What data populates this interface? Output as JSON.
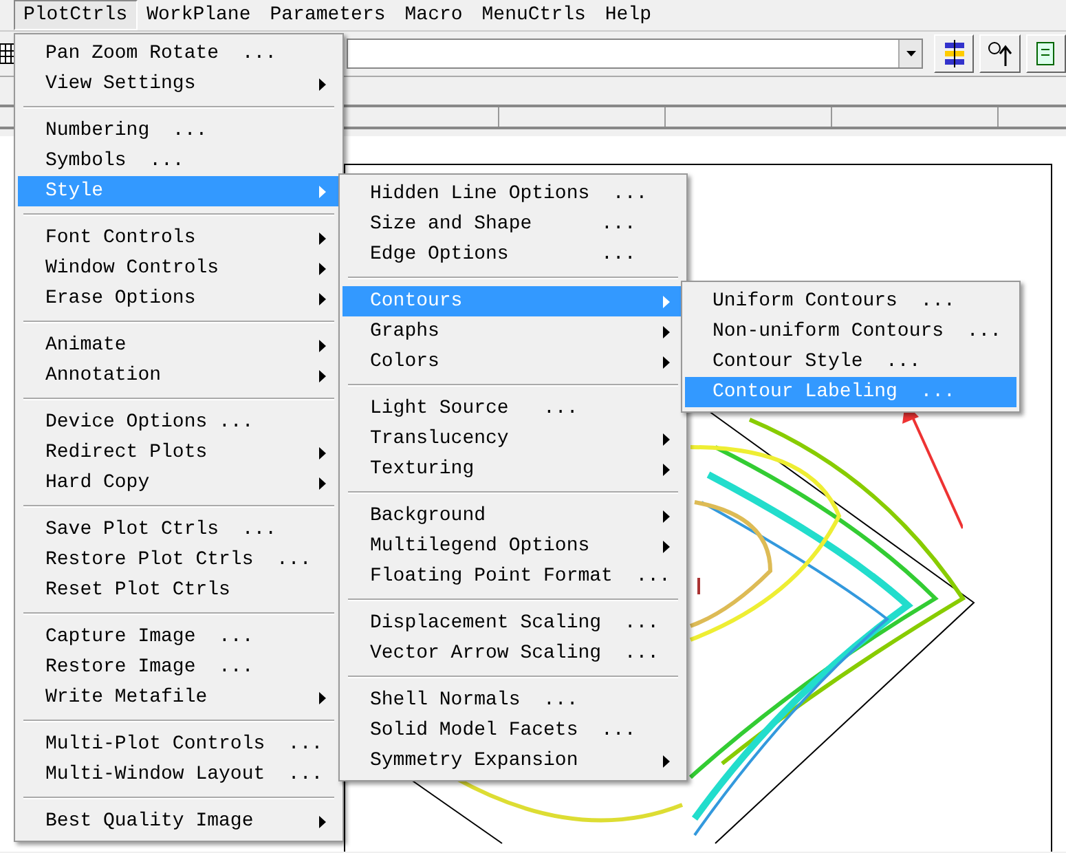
{
  "menubar": [
    {
      "label": "PlotCtrls",
      "selected": true
    },
    {
      "label": "WorkPlane",
      "selected": false
    },
    {
      "label": "Parameters",
      "selected": false
    },
    {
      "label": "Macro",
      "selected": false
    },
    {
      "label": "MenuCtrls",
      "selected": false
    },
    {
      "label": "Help",
      "selected": false
    }
  ],
  "menus": [
    {
      "groups": [
        [
          {
            "label": "Pan Zoom Rotate  ...",
            "submenu": false,
            "selected": false
          },
          {
            "label": "View Settings",
            "submenu": true,
            "selected": false
          }
        ],
        [
          {
            "label": "Numbering  ...",
            "submenu": false,
            "selected": false
          },
          {
            "label": "Symbols  ...",
            "submenu": false,
            "selected": false
          },
          {
            "label": "Style",
            "submenu": true,
            "selected": true
          }
        ],
        [
          {
            "label": "Font Controls",
            "submenu": true,
            "selected": false
          },
          {
            "label": "Window Controls",
            "submenu": true,
            "selected": false
          },
          {
            "label": "Erase Options",
            "submenu": true,
            "selected": false
          }
        ],
        [
          {
            "label": "Animate",
            "submenu": true,
            "selected": false
          },
          {
            "label": "Annotation",
            "submenu": true,
            "selected": false
          }
        ],
        [
          {
            "label": "Device Options ...",
            "submenu": false,
            "selected": false
          },
          {
            "label": "Redirect Plots",
            "submenu": true,
            "selected": false
          },
          {
            "label": "Hard Copy",
            "submenu": true,
            "selected": false
          }
        ],
        [
          {
            "label": "Save Plot Ctrls  ...",
            "submenu": false,
            "selected": false
          },
          {
            "label": "Restore Plot Ctrls  ...",
            "submenu": false,
            "selected": false
          },
          {
            "label": "Reset Plot Ctrls",
            "submenu": false,
            "selected": false
          }
        ],
        [
          {
            "label": "Capture Image  ...",
            "submenu": false,
            "selected": false
          },
          {
            "label": "Restore Image  ...",
            "submenu": false,
            "selected": false
          },
          {
            "label": "Write Metafile",
            "submenu": true,
            "selected": false
          }
        ],
        [
          {
            "label": "Multi-Plot Controls  ...",
            "submenu": false,
            "selected": false
          },
          {
            "label": "Multi-Window Layout  ...",
            "submenu": false,
            "selected": false
          }
        ],
        [
          {
            "label": "Best Quality Image",
            "submenu": true,
            "selected": false
          }
        ]
      ]
    },
    {
      "groups": [
        [
          {
            "label": "Hidden Line Options  ...",
            "submenu": false,
            "selected": false
          },
          {
            "label": "Size and Shape      ...",
            "submenu": false,
            "selected": false
          },
          {
            "label": "Edge Options        ...",
            "submenu": false,
            "selected": false
          }
        ],
        [
          {
            "label": "Contours",
            "submenu": true,
            "selected": true
          },
          {
            "label": "Graphs",
            "submenu": true,
            "selected": false
          },
          {
            "label": "Colors",
            "submenu": true,
            "selected": false
          }
        ],
        [
          {
            "label": "Light Source   ...",
            "submenu": false,
            "selected": false
          },
          {
            "label": "Translucency",
            "submenu": true,
            "selected": false
          },
          {
            "label": "Texturing",
            "submenu": true,
            "selected": false
          }
        ],
        [
          {
            "label": "Background",
            "submenu": true,
            "selected": false
          },
          {
            "label": "Multilegend Options",
            "submenu": true,
            "selected": false
          },
          {
            "label": "Floating Point Format  ...",
            "submenu": false,
            "selected": false
          }
        ],
        [
          {
            "label": "Displacement Scaling  ...",
            "submenu": false,
            "selected": false
          },
          {
            "label": "Vector Arrow Scaling  ...",
            "submenu": false,
            "selected": false
          }
        ],
        [
          {
            "label": "Shell Normals  ...",
            "submenu": false,
            "selected": false
          },
          {
            "label": "Solid Model Facets  ...",
            "submenu": false,
            "selected": false
          },
          {
            "label": "Symmetry Expansion",
            "submenu": true,
            "selected": false
          }
        ]
      ]
    },
    {
      "groups": [
        [
          {
            "label": "Uniform Contours  ...",
            "submenu": false,
            "selected": false
          },
          {
            "label": "Non-uniform Contours  ...",
            "submenu": false,
            "selected": false
          },
          {
            "label": "Contour Style  ...",
            "submenu": false,
            "selected": false
          },
          {
            "label": "Contour Labeling  ...",
            "submenu": false,
            "selected": true
          }
        ]
      ]
    }
  ]
}
